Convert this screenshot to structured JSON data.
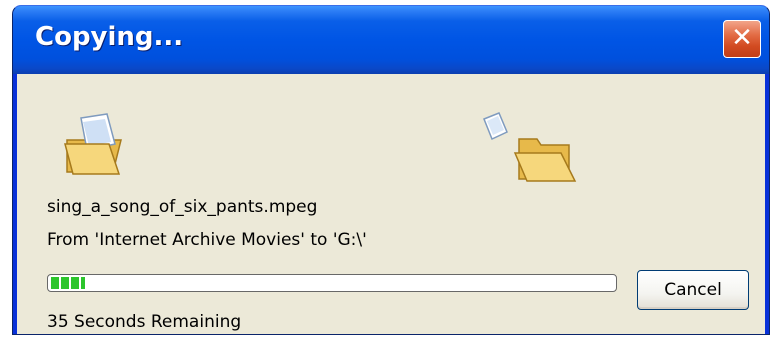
{
  "window": {
    "title": "Copying...",
    "close_label": "✕"
  },
  "icons": {
    "source": "folder-with-document-icon",
    "flying": "flying-document-icon",
    "destination": "open-folder-icon"
  },
  "copy": {
    "file_name": "sing_a_song_of_six_pants.mpeg",
    "from_to": "From 'Internet Archive Movies' to 'G:\\'",
    "progress_fraction": 0.06,
    "remaining_text": "35 Seconds Remaining",
    "cancel_label": "Cancel"
  },
  "colors": {
    "title_bar": "#0055e5",
    "close_button": "#d24b21",
    "client_background": "#ece9d8",
    "progress_green": "#2cc52c"
  }
}
